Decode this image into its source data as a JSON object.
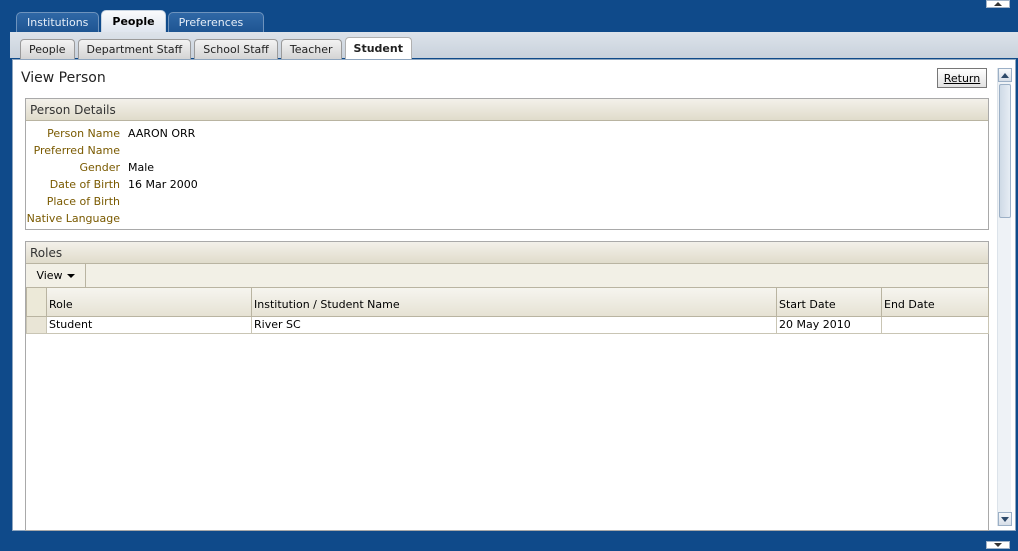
{
  "top_tabs": [
    "Institutions",
    "People",
    "Preferences"
  ],
  "top_tabs_active": "People",
  "sub_tabs": [
    "People",
    "Department Staff",
    "School Staff",
    "Teacher",
    "Student"
  ],
  "sub_tabs_active": "Student",
  "page": {
    "title": "View Person",
    "return_label": "Return"
  },
  "person_details": {
    "header": "Person Details",
    "fields": [
      {
        "label": "Person Name",
        "value": "AARON ORR"
      },
      {
        "label": "Preferred Name",
        "value": ""
      },
      {
        "label": "Gender",
        "value": "Male"
      },
      {
        "label": "Date of Birth",
        "value": "16 Mar 2000"
      },
      {
        "label": "Place of Birth",
        "value": ""
      },
      {
        "label": "Native Language",
        "value": ""
      }
    ]
  },
  "roles": {
    "header": "Roles",
    "view_label": "View",
    "columns": [
      "Role",
      "Institution / Student Name",
      "Start Date",
      "End Date"
    ],
    "rows": [
      [
        "Student",
        "River SC",
        "20 May 2010",
        ""
      ]
    ]
  }
}
